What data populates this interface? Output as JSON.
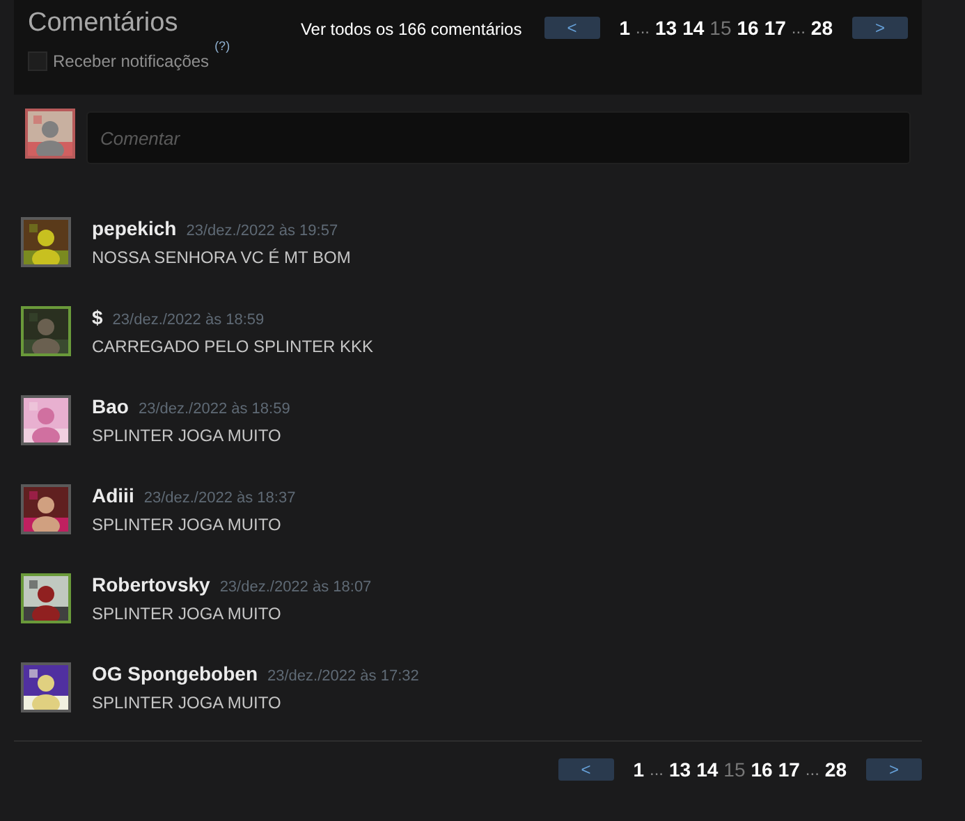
{
  "header": {
    "title": "Comentários",
    "view_all": "Ver todos os 166 comentários",
    "subscribe": {
      "label": "Receber notificações",
      "checked": false,
      "help": "(?)"
    }
  },
  "top_pager": {
    "prev": "<",
    "next": ">",
    "pages": [
      {
        "kind": "page",
        "label": "1",
        "selected": false
      },
      {
        "kind": "ellipsis",
        "label": "..."
      },
      {
        "kind": "page",
        "label": "13",
        "selected": false
      },
      {
        "kind": "page",
        "label": "14",
        "selected": false
      },
      {
        "kind": "page",
        "label": "15",
        "selected": true
      },
      {
        "kind": "page",
        "label": "16",
        "selected": false
      },
      {
        "kind": "page",
        "label": "17",
        "selected": false
      },
      {
        "kind": "ellipsis",
        "label": "..."
      },
      {
        "kind": "page",
        "label": "28",
        "selected": false
      }
    ]
  },
  "composer": {
    "placeholder": "Comentar"
  },
  "comments": [
    {
      "author": "pepekich",
      "date": "23/dez./2022 às 19:57",
      "text": "NOSSA SENHORA VC É MT BOM",
      "color": "#5a5a5a"
    },
    {
      "author": "$",
      "date": "23/dez./2022 às 18:59",
      "text": "CARREGADO PELO SPLINTER KKK",
      "color": "#6a9a3a"
    },
    {
      "author": "Bao",
      "date": "23/dez./2022 às 18:59",
      "text": "SPLINTER JOGA MUITO",
      "color": "#5a5a5a"
    },
    {
      "author": "Adiii",
      "date": "23/dez./2022 às 18:37",
      "text": "SPLINTER JOGA MUITO",
      "color": "#5a5a5a"
    },
    {
      "author": "Robertovsky",
      "date": "23/dez./2022 às 18:07",
      "text": "SPLINTER JOGA MUITO",
      "color": "#6a9a3a"
    },
    {
      "author": "OG Spongeboben",
      "date": "23/dez./2022 às 17:32",
      "text": "SPLINTER JOGA MUITO",
      "color": "#5a5a5a"
    }
  ],
  "bottom_pager": {
    "prev": "<",
    "next": ">",
    "pages": [
      {
        "kind": "page",
        "label": "1",
        "selected": false
      },
      {
        "kind": "ellipsis",
        "label": "..."
      },
      {
        "kind": "page",
        "label": "13",
        "selected": false
      },
      {
        "kind": "page",
        "label": "14",
        "selected": false
      },
      {
        "kind": "page",
        "label": "15",
        "selected": true
      },
      {
        "kind": "page",
        "label": "16",
        "selected": false
      },
      {
        "kind": "page",
        "label": "17",
        "selected": false
      },
      {
        "kind": "ellipsis",
        "label": "..."
      },
      {
        "kind": "page",
        "label": "28",
        "selected": false
      }
    ]
  }
}
